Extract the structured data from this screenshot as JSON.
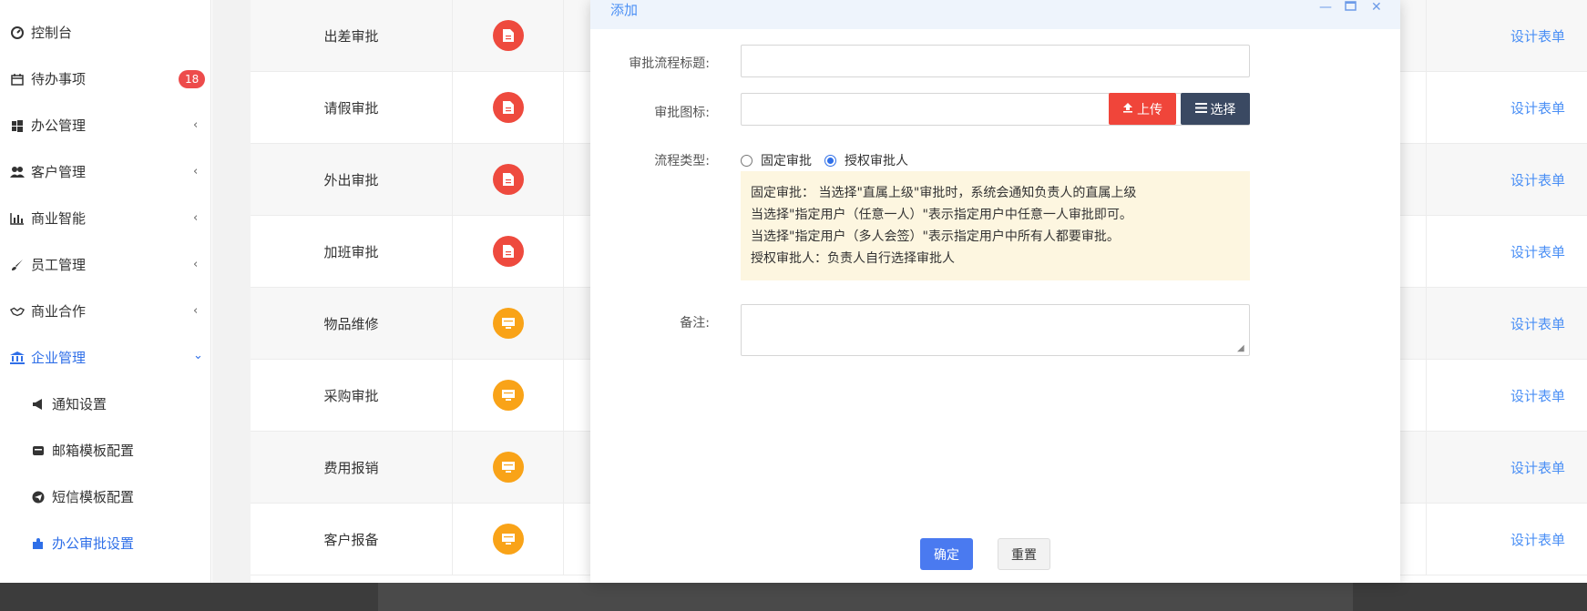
{
  "sidebar": {
    "items": [
      {
        "label": "控制台",
        "icon": "dashboard-icon"
      },
      {
        "label": "待办事项",
        "icon": "calendar-icon",
        "badge": "18"
      },
      {
        "label": "办公管理",
        "icon": "windows-icon"
      },
      {
        "label": "客户管理",
        "icon": "users-icon"
      },
      {
        "label": "商业智能",
        "icon": "bar-chart-icon"
      },
      {
        "label": "员工管理",
        "icon": "brush-icon"
      },
      {
        "label": "商业合作",
        "icon": "handshake-icon"
      },
      {
        "label": "企业管理",
        "icon": "bank-icon"
      }
    ],
    "subitems": [
      {
        "label": "通知设置",
        "icon": "megaphone-icon"
      },
      {
        "label": "邮箱模板配置",
        "icon": "envelope-icon"
      },
      {
        "label": "短信模板配置",
        "icon": "telegram-icon"
      },
      {
        "label": "办公审批设置",
        "icon": "puzzle-icon"
      }
    ]
  },
  "table": {
    "rows": [
      {
        "name": "出差审批",
        "icon_color": "#ee4a3e",
        "action": "设计表单"
      },
      {
        "name": "请假审批",
        "icon_color": "#ee4a3e",
        "action": "设计表单"
      },
      {
        "name": "外出审批",
        "icon_color": "#ee4a3e",
        "action": "设计表单"
      },
      {
        "name": "加班审批",
        "icon_color": "#ee4a3e",
        "action": "设计表单"
      },
      {
        "name": "物品维修",
        "icon_color": "#f9a318",
        "action": "设计表单"
      },
      {
        "name": "采购审批",
        "icon_color": "#f9a318",
        "action": "设计表单"
      },
      {
        "name": "费用报销",
        "icon_color": "#f9a318",
        "action": "设计表单"
      },
      {
        "name": "客户报备",
        "icon_color": "#f9a318",
        "action": "设计表单"
      }
    ]
  },
  "modal": {
    "title": "添加",
    "fields": {
      "title_label": "审批流程标题:",
      "icon_label": "审批图标:",
      "type_label": "流程类型:",
      "remark_label": "备注:"
    },
    "upload_label": "上传",
    "select_label": "选择",
    "radio_options": [
      "固定审批",
      "授权审批人"
    ],
    "radio_selected": "授权审批人",
    "help_lines": [
      "固定审批： 当选择\"直属上级\"审批时，系统会通知负责人的直属上级",
      "当选择\"指定用户（任意一人）\"表示指定用户中任意一人审批即可。",
      "当选择\"指定用户（多人会签）\"表示指定用户中所有人都要审批。",
      "授权审批人：负责人自行选择审批人"
    ],
    "ok_label": "确定",
    "reset_label": "重置"
  },
  "colors": {
    "accent": "#2f6fe8",
    "link": "#4a8ff5",
    "danger": "#f0453a",
    "badge": "#ed4b4b"
  }
}
